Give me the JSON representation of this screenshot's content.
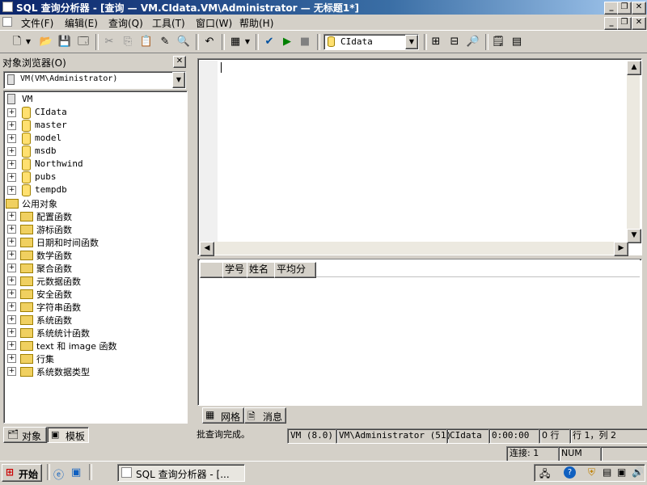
{
  "window": {
    "title": "SQL 查询分析器 - [查询 — VM.CIdata.VM\\Administrator — 无标题1*]"
  },
  "menu": [
    "文件(F)",
    "编辑(E)",
    "查询(Q)",
    "工具(T)",
    "窗口(W)",
    "帮助(H)"
  ],
  "toolbar": {
    "database_select": "CIdata"
  },
  "object_browser": {
    "title": "对象浏览器(O)",
    "server_select": "VM(VM\\Administrator)",
    "root": "VM",
    "databases": [
      "CIdata",
      "master",
      "model",
      "msdb",
      "Northwind",
      "pubs",
      "tempdb"
    ],
    "common_objects": "公用对象",
    "folders": [
      "配置函数",
      "游标函数",
      "日期和时间函数",
      "数学函数",
      "聚合函数",
      "元数据函数",
      "安全函数",
      "字符串函数",
      "系统函数",
      "系统统计函数",
      "text 和 image 函数",
      "行集",
      "系统数据类型"
    ],
    "tabs": {
      "objects": "对象",
      "templates": "模板"
    }
  },
  "results": {
    "columns": [
      "学号",
      "姓名",
      "平均分"
    ],
    "tabs": {
      "grid": "网格",
      "messages": "消息"
    }
  },
  "status": {
    "message": "批查询完成。",
    "server": "VM (8.0)",
    "user": "VM\\Administrator (51)",
    "database": "CIdata",
    "elapsed": "0:00:00",
    "rows": "0 行",
    "position": "行 1，列 2",
    "connections": "连接: 1",
    "num": "NUM"
  },
  "taskbar": {
    "start": "开始",
    "task": "SQL 查询分析器 - [..."
  },
  "colors": {
    "title_start": "#0a246a",
    "title_end": "#a6caf0",
    "chrome": "#d4d0c8"
  }
}
